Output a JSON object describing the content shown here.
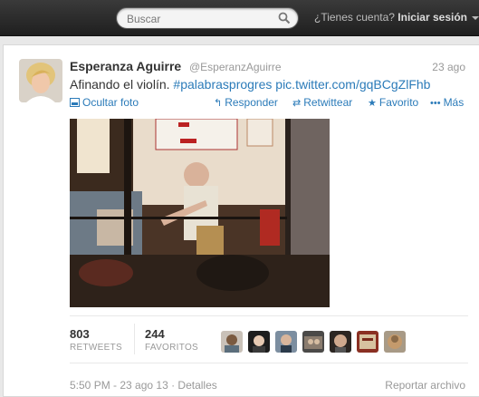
{
  "topbar": {
    "search_placeholder": "Buscar",
    "account_prompt": "¿Tienes cuenta?",
    "login_label": "Iniciar sesión"
  },
  "tweet": {
    "name": "Esperanza Aguirre",
    "handle": "@EsperanzAguirre",
    "date": "23 ago",
    "text_prefix": "Afinando el violín.",
    "hashtag": "#palabrasprogres",
    "link": "pic.twitter.com/gqBCgZlFhb",
    "actions": {
      "hide_photo": "Ocultar foto",
      "reply": "Responder",
      "retweet": "Retwittear",
      "favorite": "Favorito",
      "more": "Más"
    },
    "stats": {
      "retweets_count": "803",
      "retweets_label": "RETWEETS",
      "favorites_count": "244",
      "favorites_label": "FAVORITOS"
    },
    "footer": {
      "timestamp": "5:50 PM - 23 ago 13 · Detalles",
      "report": "Reportar archivo"
    }
  },
  "colors": {
    "link": "#2b7bb9",
    "muted": "#999999",
    "topbar": "#2a2a2a"
  }
}
